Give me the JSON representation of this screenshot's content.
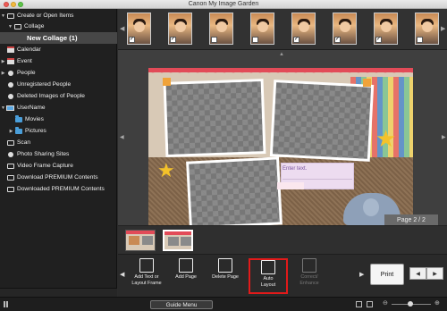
{
  "window": {
    "title": "Canon My Image Garden"
  },
  "sidebar": {
    "items": [
      {
        "label": "Create or Open Items",
        "icon": "checkbox-icon",
        "expanded": true
      },
      {
        "label": "Collage",
        "icon": "checkbox-icon",
        "expanded": true
      },
      {
        "label": "New Collage (1)",
        "selected": true
      },
      {
        "label": "Calendar",
        "icon": "calendar-icon"
      },
      {
        "label": "Event",
        "icon": "calendar-icon",
        "expandable": true
      },
      {
        "label": "People",
        "icon": "person-icon",
        "expandable": true
      },
      {
        "label": "Unregistered People",
        "icon": "person-icon"
      },
      {
        "label": "Deleted Images of People",
        "icon": "person-icon"
      },
      {
        "label": "UserName",
        "icon": "monitor-icon",
        "expanded": true
      },
      {
        "label": "Movies",
        "icon": "folder-icon"
      },
      {
        "label": "Pictures",
        "icon": "folder-icon",
        "expandable": true
      },
      {
        "label": "Scan",
        "icon": "scanner-icon"
      },
      {
        "label": "Photo Sharing Sites",
        "icon": "globe-icon"
      },
      {
        "label": "Video Frame Capture",
        "icon": "film-icon"
      },
      {
        "label": "Download PREMIUM Contents",
        "icon": "download-icon"
      },
      {
        "label": "Downloaded PREMIUM Contents",
        "icon": "download-icon"
      }
    ]
  },
  "canvas": {
    "note_placeholder": "Enter text.",
    "page_indicator": "Page 2 / 2"
  },
  "toolbar": {
    "tools": [
      {
        "label": "Add Text or\nLayout Frame",
        "enabled": true
      },
      {
        "label": "Add Page",
        "enabled": true
      },
      {
        "label": "Delete Page",
        "enabled": true
      },
      {
        "label": "Auto\nLayout",
        "enabled": true,
        "highlighted": true
      },
      {
        "label": "Correct/\nEnhance",
        "enabled": false
      }
    ],
    "print_label": "Print"
  },
  "status": {
    "guide_menu_label": "Guide Menu"
  },
  "colors": {
    "highlight": "#e21a1a",
    "accent": "#4a9ed9",
    "banner": "#e24b58"
  }
}
